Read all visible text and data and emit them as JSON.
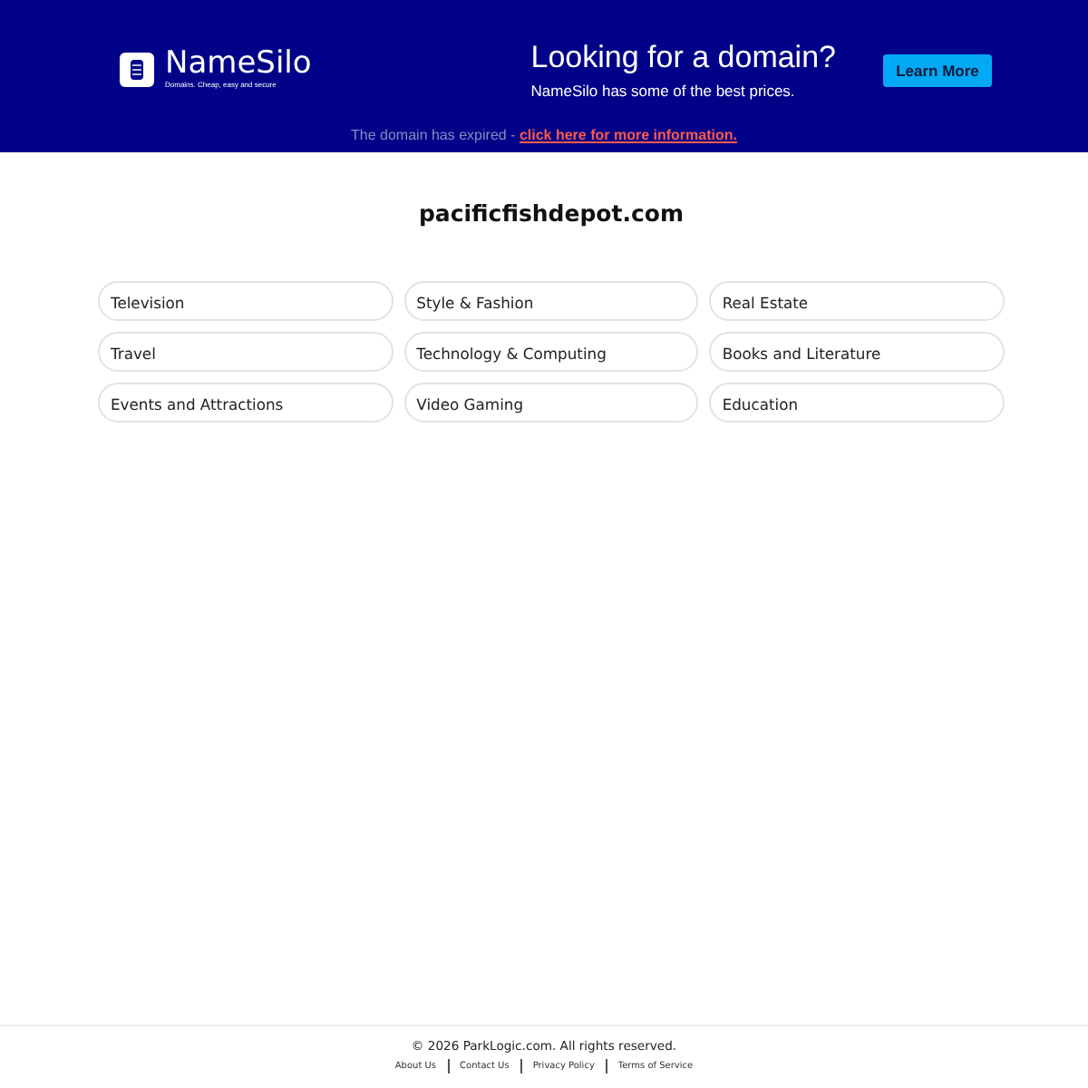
{
  "header": {
    "logo_name": "NameSilo",
    "logo_tagline": "Domains. Cheap, easy and secure",
    "promo_title": "Looking for a domain?",
    "promo_text": "NameSilo has some of the best prices.",
    "button": "Learn More",
    "notice": "The domain has expired - ",
    "notice_link": "click here for more information."
  },
  "domain": "pacificfishdepot.com",
  "categories": [
    {
      "label": "Television"
    },
    {
      "label": "Style & Fashion"
    },
    {
      "label": "Real Estate"
    },
    {
      "label": "Travel"
    },
    {
      "label": "Technology & Computing"
    },
    {
      "label": "Books and Literature"
    },
    {
      "label": "Events and Attractions"
    },
    {
      "label": "Video Gaming"
    },
    {
      "label": "Education"
    }
  ],
  "footer": {
    "copyright": "© 2026 ParkLogic.com. All rights reserved.",
    "links": [
      "About Us",
      "Contact Us",
      "Privacy Policy",
      "Terms of Service"
    ]
  }
}
